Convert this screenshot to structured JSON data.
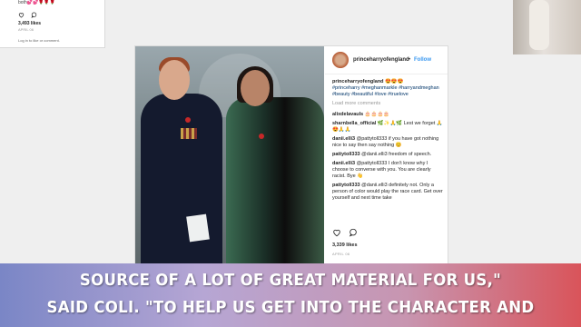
{
  "background_left": {
    "emoji_row": "both💕💕🌹🌹🌹",
    "likes": "3,493 likes",
    "date": "APRIL 06",
    "login": "Log in to like or comment."
  },
  "post": {
    "username": "princeharryofengland",
    "separator": "•",
    "follow_label": "Follow",
    "caption": {
      "username": "princeharryofengland",
      "emoji": "😍😍😍",
      "hashtags": "#princeharry #meghanmarkle #harryandmeghan #beauty #beautiful #love #truelove"
    },
    "load_more": "Load more comments",
    "comments": [
      {
        "username": "alixdelavauls",
        "text": "🎂🎂🎂🎂"
      },
      {
        "username": "sharnbella_official",
        "text": "🌿✨🙏🌿 Lest we forget 🙏😍🙏🙏"
      },
      {
        "username": "danii.elli3",
        "text": "@pattytoll333 if you have got nothing nice to say then say nothing 😊"
      },
      {
        "username": "pattytoll333",
        "text": "@danii.elli3 freedom of speech."
      },
      {
        "username": "danii.elli3",
        "text": "@pattytoll333 I don't know why I choose to converse with you. You are clearly racist. Bye 👋"
      },
      {
        "username": "pattytoll333",
        "text": "@danii.elli3 definitely not. Only a person of color would play the race card. Get over yourself and next time take"
      }
    ],
    "likes": "3,339 likes",
    "date": "APRIL 06"
  },
  "caption_banner": {
    "line1": "SOURCE OF A LOT OF GREAT MATERIAL FOR US,\"",
    "line2": "SAID COLI. \"TO HELP US GET INTO THE CHARACTER AND"
  }
}
